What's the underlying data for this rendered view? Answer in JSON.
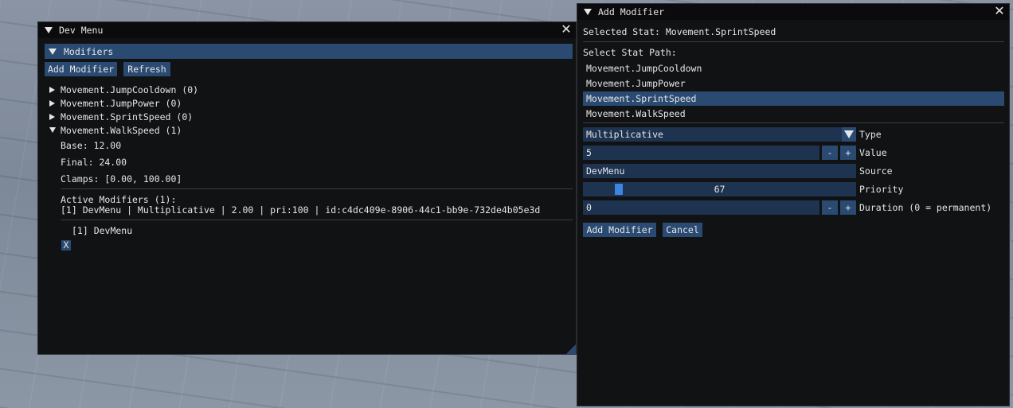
{
  "colors": {
    "window_bg": "#111214",
    "titlebar": "#0b0b0d",
    "button": "#2a4a72",
    "field": "#1d3350",
    "header": "#2a4a72",
    "selected": "#2a4a72",
    "slider_grab": "#3d85e0"
  },
  "dev_menu": {
    "title": "Dev Menu",
    "section_header": "Modifiers",
    "add_modifier_label": "Add Modifier",
    "refresh_label": "Refresh",
    "tree": [
      {
        "label": "Movement.JumpCooldown (0)",
        "expanded": false
      },
      {
        "label": "Movement.JumpPower (0)",
        "expanded": false
      },
      {
        "label": "Movement.SprintSpeed (0)",
        "expanded": false
      },
      {
        "label": "Movement.WalkSpeed (1)",
        "expanded": true
      }
    ],
    "details": {
      "base": "Base: 12.00",
      "final": "Final: 24.00",
      "clamps": "Clamps: [0.00, 100.00]",
      "active_header": "Active Modifiers (1):",
      "active_line": "[1] DevMenu | Multiplicative | 2.00 | pri:100 | id:c4dc409e-8906-44c1-bb9e-732de4b05e3d",
      "entry_label": "[1] DevMenu",
      "remove_label": "X"
    }
  },
  "add_modifier": {
    "title": "Add Modifier",
    "selected_stat": "Selected Stat: Movement.SprintSpeed",
    "select_stat_path": "Select Stat Path:",
    "stat_paths": [
      {
        "label": "Movement.JumpCooldown",
        "selected": false
      },
      {
        "label": "Movement.JumpPower",
        "selected": false
      },
      {
        "label": "Movement.SprintSpeed",
        "selected": true
      },
      {
        "label": "Movement.WalkSpeed",
        "selected": false
      }
    ],
    "type": {
      "value": "Multiplicative",
      "label": "Type"
    },
    "value": {
      "value": "5",
      "label": "Value",
      "minus": "-",
      "plus": "+"
    },
    "source": {
      "value": "DevMenu",
      "label": "Source"
    },
    "priority": {
      "value": "67",
      "label": "Priority",
      "fraction": 0.067
    },
    "duration": {
      "value": "0",
      "label": "Duration (0 = permanent)",
      "minus": "-",
      "plus": "+"
    },
    "add_button_label": "Add Modifier",
    "cancel_button_label": "Cancel"
  },
  "icons": {
    "close": "close-icon",
    "collapse": "triangle-down-icon",
    "expand": "triangle-right-icon",
    "combo": "chevron-down-icon"
  }
}
